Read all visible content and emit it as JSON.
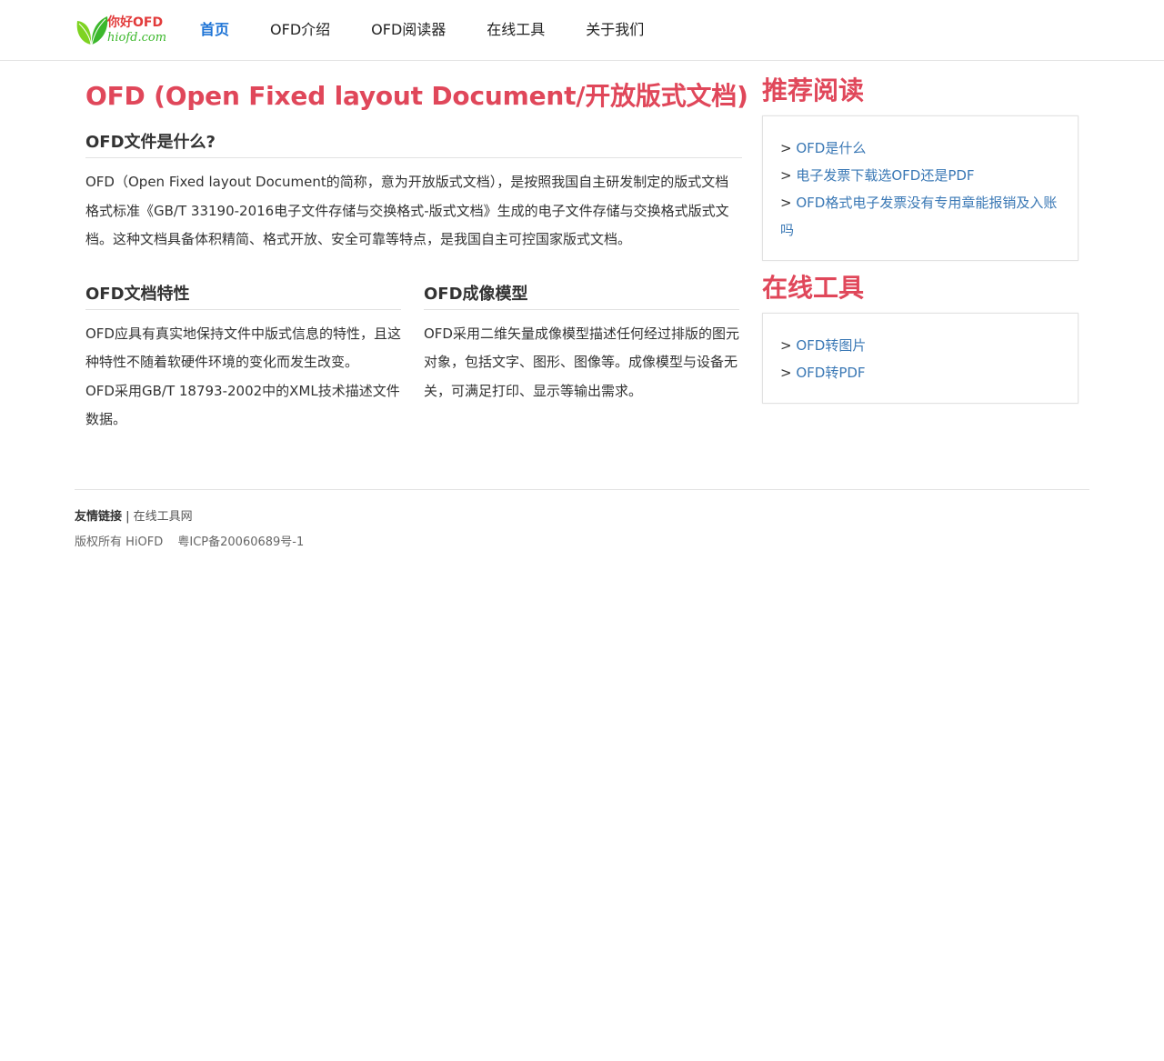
{
  "logo": {
    "top": "你好OFD",
    "bottom": "hiofd.com"
  },
  "nav": {
    "items": [
      {
        "label": "首页"
      },
      {
        "label": "OFD介绍"
      },
      {
        "label": "OFD阅读器"
      },
      {
        "label": "在线工具"
      },
      {
        "label": "关于我们"
      }
    ]
  },
  "main": {
    "title": "OFD (Open Fixed layout Document/开放版式文档)",
    "what": {
      "heading": "OFD文件是什么?",
      "text": "OFD（Open Fixed layout Document的简称，意为开放版式文档），是按照我国自主研发制定的版式文档格式标准《GB/T 33190-2016电子文件存储与交换格式-版式文档》生成的电子文件存储与交换格式版式文档。这种文档具备体积精简、格式开放、安全可靠等特点，是我国自主可控国家版式文档。"
    },
    "features": {
      "heading": "OFD文档特性",
      "text1": "OFD应具有真实地保持文件中版式信息的特性，且这种特性不随着软硬件环境的变化而发生改变。",
      "text2": "OFD采用GB/T 18793-2002中的XML技术描述文件数据。"
    },
    "imaging": {
      "heading": "OFD成像模型",
      "text": "OFD采用二维矢量成像模型描述任何经过排版的图元对象，包括文字、图形、图像等。成像模型与设备无关，可满足打印、显示等输出需求。"
    }
  },
  "sidebar": {
    "reading": {
      "heading": "推荐阅读",
      "prefix": "> ",
      "links": [
        "OFD是什么",
        "电子发票下载选OFD还是PDF",
        "OFD格式电子发票没有专用章能报销及入账吗"
      ]
    },
    "tools": {
      "heading": "在线工具",
      "prefix": "> ",
      "links": [
        "OFD转图片",
        "OFD转PDF"
      ]
    }
  },
  "footer": {
    "friends_label": "友情链接",
    "separator": " | ",
    "friend_link": "在线工具网",
    "copyright": "版权所有 HiOFD",
    "icp": "粤ICP备20060689号-1"
  },
  "colors": {
    "accent": "#e0475a",
    "nav_active": "#1e74d6",
    "link": "#3a78b5"
  }
}
